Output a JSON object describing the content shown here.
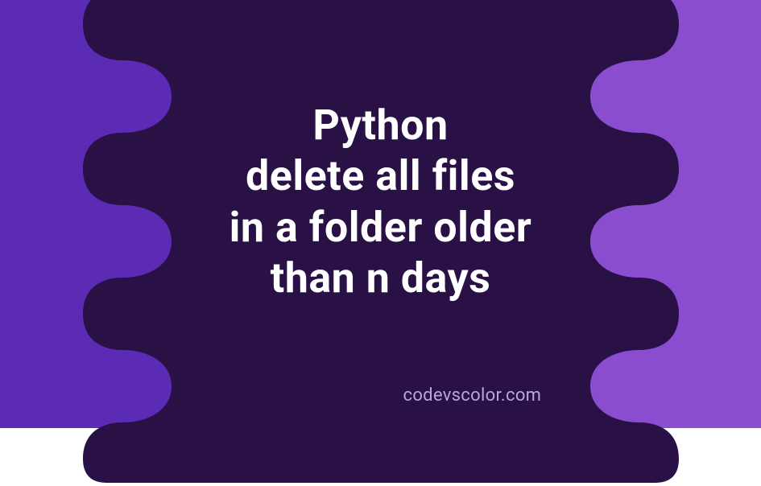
{
  "title": {
    "line1": "Python",
    "line2": "delete all files",
    "line3": "in a folder older",
    "line4": "than n days"
  },
  "footer": "codevscolor.com",
  "colors": {
    "left_bg": "#5b2bb5",
    "right_bg": "#8a4dd0",
    "blob": "#291045",
    "text": "#ffffff",
    "footer_text": "#b8a8d8"
  }
}
